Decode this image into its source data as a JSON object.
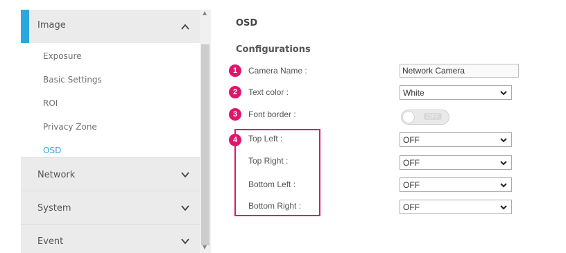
{
  "sidebar": {
    "expanded_section": "Image",
    "sub_items": [
      "Exposure",
      "Basic Settings",
      "ROI",
      "Privacy Zone",
      "OSD"
    ],
    "active_item": "OSD",
    "sections": [
      "Network",
      "System",
      "Event"
    ]
  },
  "main": {
    "title": "OSD",
    "subtitle": "Configurations",
    "camera_name": {
      "badge": "1",
      "label": "Camera Name :",
      "value": "Network Camera"
    },
    "text_color": {
      "badge": "2",
      "label": "Text color :",
      "value": "White"
    },
    "font_border": {
      "badge": "3",
      "label": "Font border :",
      "toggle_text": "OFF",
      "enabled": false
    },
    "positions_badge": "4",
    "positions": [
      {
        "label": "Top Left :",
        "value": "OFF"
      },
      {
        "label": "Top Right :",
        "value": "OFF"
      },
      {
        "label": "Bottom Left :",
        "value": "OFF"
      },
      {
        "label": "Bottom Right :",
        "value": "OFF"
      }
    ]
  },
  "colors": {
    "accent": "#29a8e0",
    "callout": "#e0156c"
  },
  "icons": [
    "chevron-up-icon",
    "chevron-down-icon",
    "dropdown-arrow-icon",
    "scroll-up-icon",
    "scroll-down-icon"
  ]
}
